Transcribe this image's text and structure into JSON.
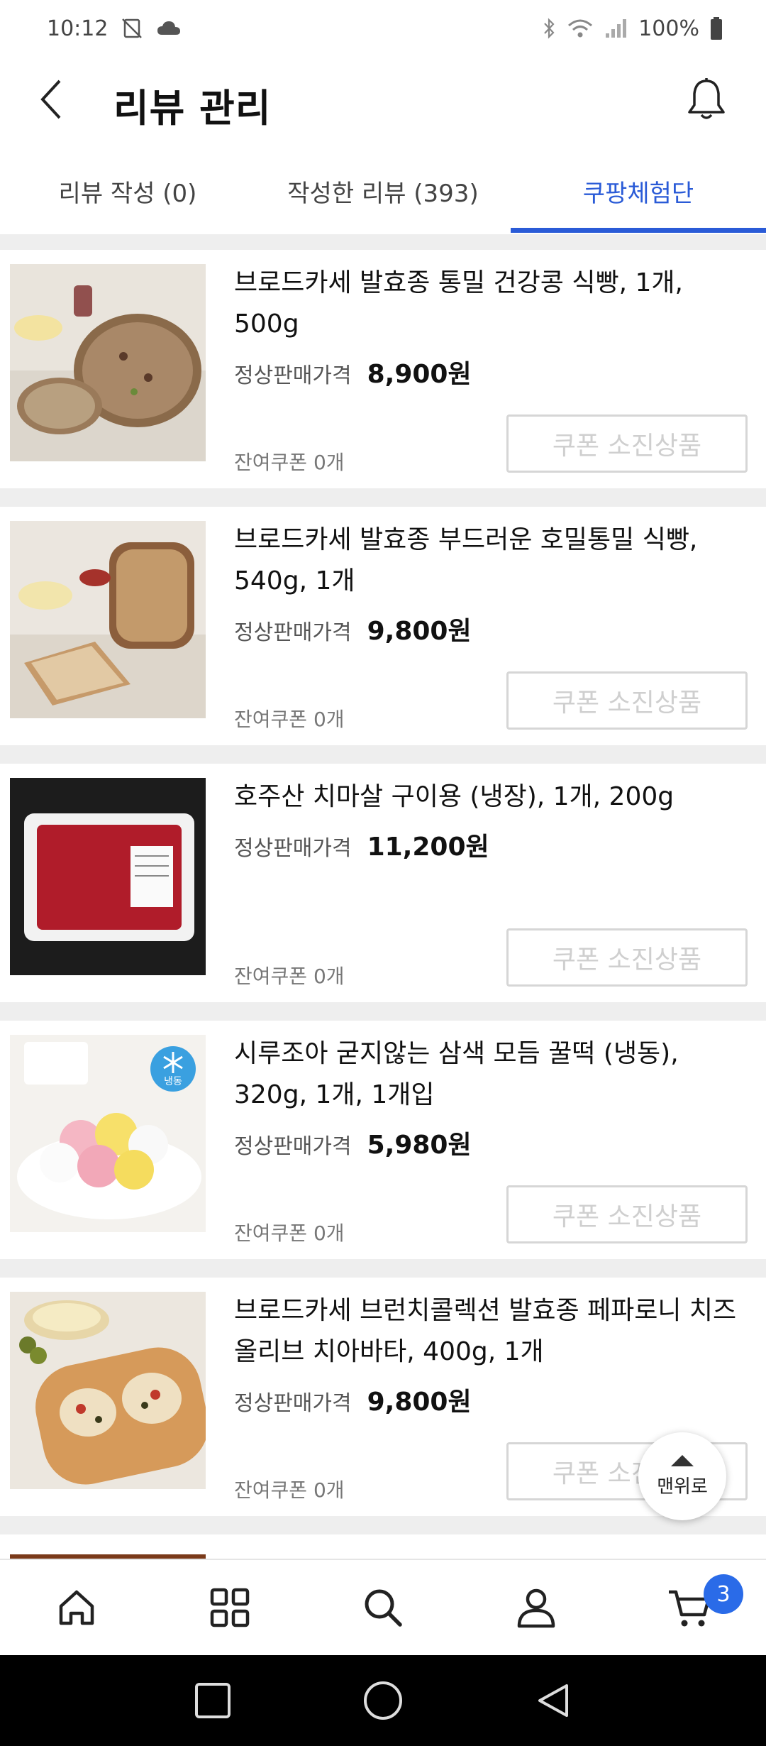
{
  "status_bar": {
    "time": "10:12",
    "battery": "100%"
  },
  "header": {
    "title": "리뷰 관리"
  },
  "tabs": [
    {
      "label": "리뷰 작성 (0)",
      "active": false
    },
    {
      "label": "작성한 리뷰 (393)",
      "active": false
    },
    {
      "label": "쿠팡체험단",
      "active": true
    }
  ],
  "products": [
    {
      "title_line1": "브로드카세 발효종 통밀 건강콩 식빵, 1개,",
      "title_line2": "500g",
      "price_label": "정상판매가격",
      "price": "8,900원",
      "coupon_remaining": "잔여쿠폰 0개",
      "coupon_button": "쿠폰 소진상품"
    },
    {
      "title_line1": "브로드카세 발효종 부드러운 호밀통밀 식빵,",
      "title_line2": "540g, 1개",
      "price_label": "정상판매가격",
      "price": "9,800원",
      "coupon_remaining": "잔여쿠폰 0개",
      "coupon_button": "쿠폰 소진상품"
    },
    {
      "title_line1": "호주산 치마살 구이용 (냉장), 1개, 200g",
      "title_line2": "",
      "price_label": "정상판매가격",
      "price": "11,200원",
      "coupon_remaining": "잔여쿠폰 0개",
      "coupon_button": "쿠폰 소진상품"
    },
    {
      "title_line1": "시루조아 굳지않는 삼색 모듬 꿀떡 (냉동),",
      "title_line2": "320g, 1개, 1개입",
      "price_label": "정상판매가격",
      "price": "5,980원",
      "coupon_remaining": "잔여쿠폰 0개",
      "coupon_button": "쿠폰 소진상품",
      "badge": "냉동"
    },
    {
      "title_line1": "브로드카세 브런치콜렉션 발효종 페파로니 치즈",
      "title_line2": "올리브 치아바타, 400g, 1개",
      "price_label": "정상판매가격",
      "price": "9,800원",
      "coupon_remaining": "잔여쿠폰 0개",
      "coupon_button": "쿠폰 소진상품"
    }
  ],
  "scroll_top": {
    "label": "맨위로"
  },
  "bottom_nav": {
    "items": [
      "home-icon",
      "categories-icon",
      "search-icon",
      "account-icon",
      "cart-icon"
    ],
    "cart_count": "3"
  },
  "colors": {
    "accent": "#2a5bd7",
    "badge": "#2a6be8",
    "divider": "#eeeeee"
  }
}
